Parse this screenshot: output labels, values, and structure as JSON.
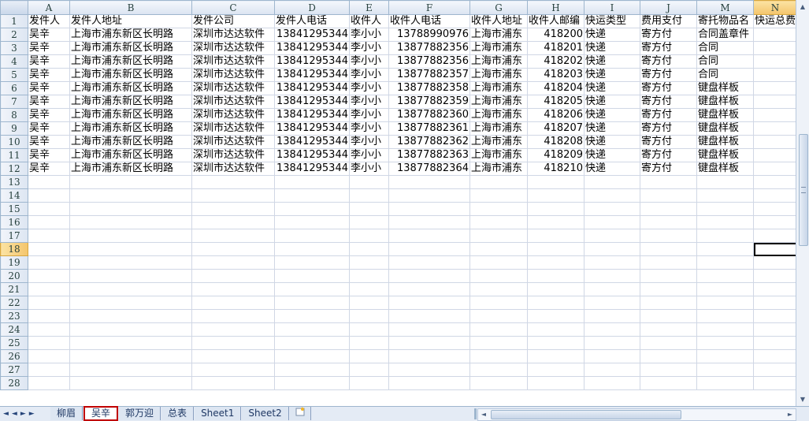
{
  "columns": [
    "A",
    "B",
    "C",
    "D",
    "E",
    "F",
    "G",
    "H",
    "I",
    "J",
    "M",
    "N"
  ],
  "row_numbers": [
    "1",
    "2",
    "3",
    "4",
    "5",
    "6",
    "7",
    "8",
    "9",
    "10",
    "11",
    "12",
    "13",
    "14",
    "15",
    "16",
    "17",
    "18",
    "19",
    "20",
    "21",
    "22",
    "23",
    "24",
    "25",
    "26",
    "27",
    "28"
  ],
  "headers": [
    "发件人",
    "发件人地址",
    "发件公司",
    "发件人电话",
    "收件人",
    "收件人电话",
    "收件人地址",
    "收件人邮编",
    "快运类型",
    "费用支付",
    "寄托物品名",
    "快运总费"
  ],
  "rows": [
    [
      "吴辛",
      "上海市浦东新区长明路",
      "深圳市达达软件",
      "13841295344",
      "李小小",
      "13788990976",
      "上海市浦东",
      "418200",
      "快递",
      "寄方付",
      "合同盖章件",
      ""
    ],
    [
      "吴辛",
      "上海市浦东新区长明路",
      "深圳市达达软件",
      "13841295344",
      "李小小",
      "13877882356",
      "上海市浦东",
      "418201",
      "快递",
      "寄方付",
      "合同",
      ""
    ],
    [
      "吴辛",
      "上海市浦东新区长明路",
      "深圳市达达软件",
      "13841295344",
      "李小小",
      "13877882356",
      "上海市浦东",
      "418202",
      "快递",
      "寄方付",
      "合同",
      ""
    ],
    [
      "吴辛",
      "上海市浦东新区长明路",
      "深圳市达达软件",
      "13841295344",
      "李小小",
      "13877882357",
      "上海市浦东",
      "418203",
      "快递",
      "寄方付",
      "合同",
      ""
    ],
    [
      "吴辛",
      "上海市浦东新区长明路",
      "深圳市达达软件",
      "13841295344",
      "李小小",
      "13877882358",
      "上海市浦东",
      "418204",
      "快递",
      "寄方付",
      "键盘样板",
      ""
    ],
    [
      "吴辛",
      "上海市浦东新区长明路",
      "深圳市达达软件",
      "13841295344",
      "李小小",
      "13877882359",
      "上海市浦东",
      "418205",
      "快递",
      "寄方付",
      "键盘样板",
      ""
    ],
    [
      "吴辛",
      "上海市浦东新区长明路",
      "深圳市达达软件",
      "13841295344",
      "李小小",
      "13877882360",
      "上海市浦东",
      "418206",
      "快递",
      "寄方付",
      "键盘样板",
      ""
    ],
    [
      "吴辛",
      "上海市浦东新区长明路",
      "深圳市达达软件",
      "13841295344",
      "李小小",
      "13877882361",
      "上海市浦东",
      "418207",
      "快递",
      "寄方付",
      "键盘样板",
      ""
    ],
    [
      "吴辛",
      "上海市浦东新区长明路",
      "深圳市达达软件",
      "13841295344",
      "李小小",
      "13877882362",
      "上海市浦东",
      "418208",
      "快递",
      "寄方付",
      "键盘样板",
      ""
    ],
    [
      "吴辛",
      "上海市浦东新区长明路",
      "深圳市达达软件",
      "13841295344",
      "李小小",
      "13877882363",
      "上海市浦东",
      "418209",
      "快递",
      "寄方付",
      "键盘样板",
      ""
    ],
    [
      "吴辛",
      "上海市浦东新区长明路",
      "深圳市达达软件",
      "13841295344",
      "李小小",
      "13877882364",
      "上海市浦东",
      "418210",
      "快递",
      "寄方付",
      "键盘样板",
      ""
    ]
  ],
  "numeric_columns": [
    3,
    5,
    7
  ],
  "active_cell": {
    "row": "18",
    "column": "N"
  },
  "sheet_tabs": [
    {
      "label": "柳眉",
      "active": false
    },
    {
      "label": "吴辛",
      "active": true
    },
    {
      "label": "郭万迎",
      "active": false
    },
    {
      "label": "总表",
      "active": false
    },
    {
      "label": "Sheet1",
      "active": false
    },
    {
      "label": "Sheet2",
      "active": false
    }
  ],
  "icons": {
    "tab_first": "◄◄",
    "tab_prev": "◄",
    "tab_next": "►",
    "tab_last": "►►",
    "insert_sheet": "new-sheet-icon",
    "scroll_up": "▲",
    "scroll_down": "▼",
    "scroll_left": "◄",
    "scroll_right": "►"
  },
  "colors": {
    "selection_header": "#f4c56c",
    "active_tab_border": "#c00000",
    "grid_line": "#d0d7e5"
  }
}
